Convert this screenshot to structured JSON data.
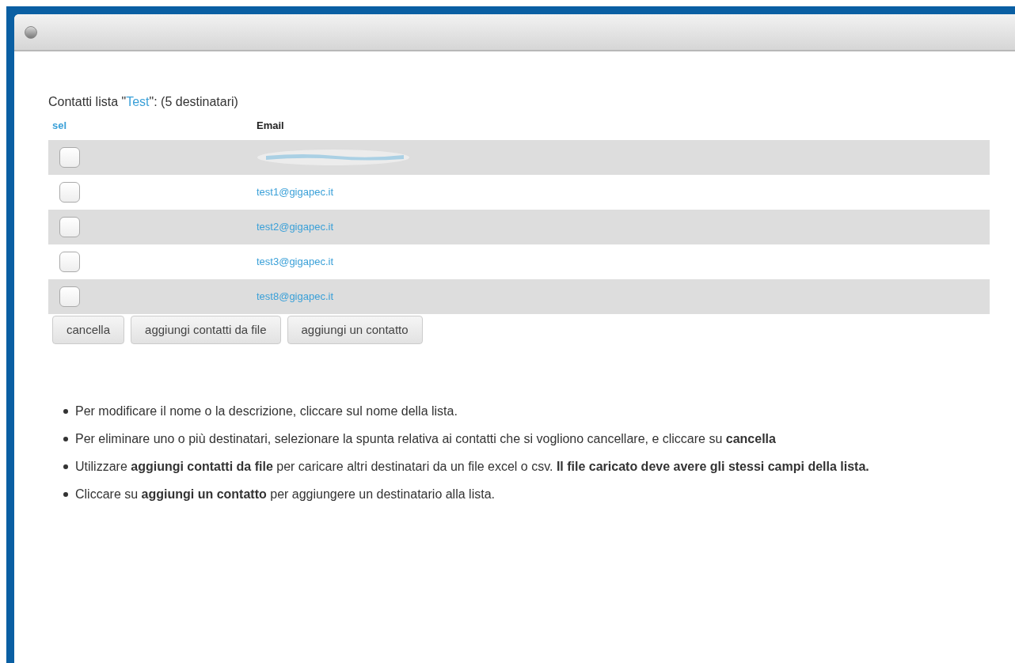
{
  "heading": {
    "prefix": "Contatti lista \"",
    "list_name": "Test",
    "suffix": "\": (5 destinatari)"
  },
  "table": {
    "columns": [
      "sel",
      "Email"
    ],
    "rows": [
      {
        "kind": "redacted",
        "checked": false
      },
      {
        "kind": "email",
        "email": "test1@gigapec.it",
        "checked": false
      },
      {
        "kind": "email",
        "email": "test2@gigapec.it",
        "checked": false
      },
      {
        "kind": "email",
        "email": "test3@gigapec.it",
        "checked": false
      },
      {
        "kind": "email",
        "email": "test8@gigapec.it",
        "checked": false
      }
    ]
  },
  "buttons": [
    "cancella",
    "aggiungi contatti da file",
    "aggiungi un contatto"
  ],
  "notes": [
    "Per modificare il nome o la descrizione, cliccare sul nome della lista.",
    "Per eliminare uno o più destinatari, selezionare la spunta relativa ai contatti che si vogliono cancellare, e cliccare su **cancella**",
    "Utilizzare **aggiungi contatti da file** per caricare altri destinatari da un file excel o csv. **Il file caricato deve avere gli stessi campi della lista.**",
    "Cliccare su **aggiungi un contatto** per aggiungere un destinatario alla lista."
  ]
}
